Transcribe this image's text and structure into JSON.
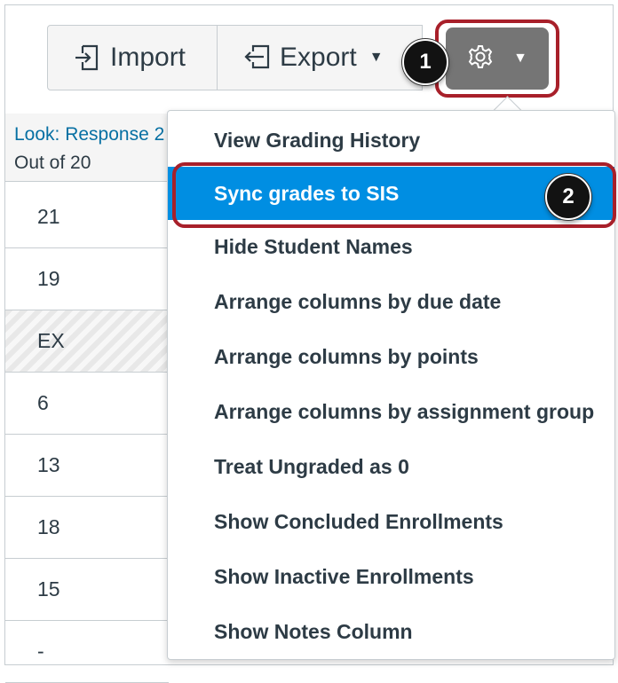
{
  "toolbar": {
    "import_label": "Import",
    "export_label": "Export",
    "import_icon": "import-icon",
    "export_icon": "export-icon",
    "settings_icon": "gear-icon"
  },
  "callouts": [
    "1",
    "2"
  ],
  "column": {
    "title": "Look: Response 2",
    "subtitle": "Out of 20",
    "cells": [
      "21",
      "19",
      "EX",
      "6",
      "13",
      "18",
      "15",
      "-"
    ]
  },
  "menu": {
    "items": [
      "View Grading History",
      "Sync grades to SIS",
      "Hide Student Names",
      "Arrange columns by due date",
      "Arrange columns by points",
      "Arrange columns by assignment group",
      "Treat Ungraded as 0",
      "Show Concluded Enrollments",
      "Show Inactive Enrollments",
      "Show Notes Column"
    ],
    "active_index": 1
  },
  "colors": {
    "accent": "#008ee2",
    "callout_outline": "#a8202a",
    "gear_button": "#757575",
    "link": "#0770a3"
  }
}
